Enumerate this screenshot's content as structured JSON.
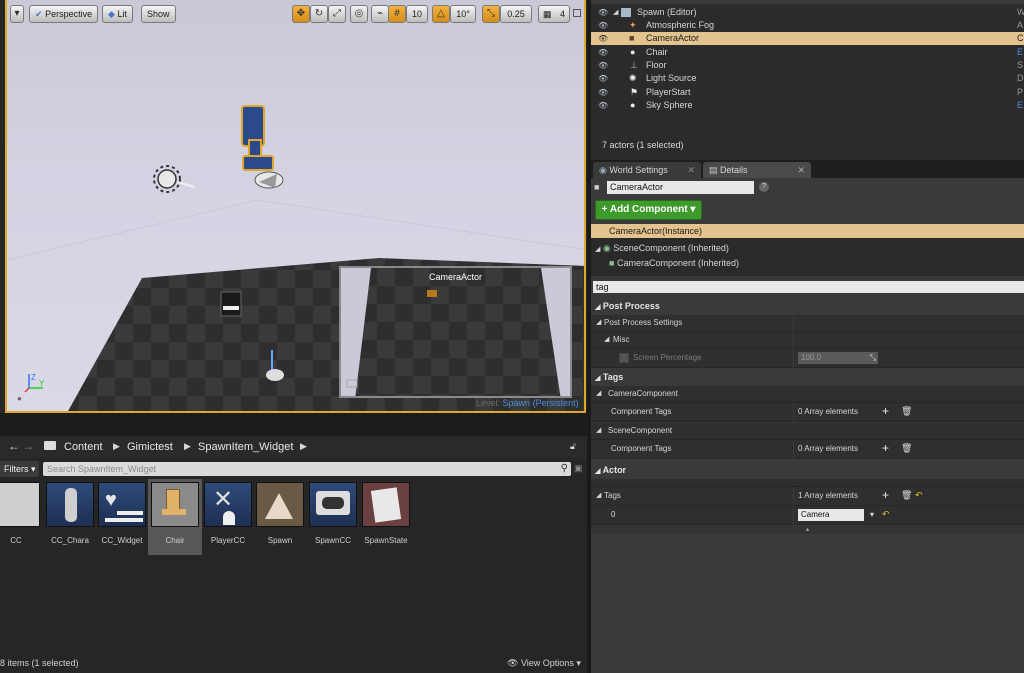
{
  "viewport": {
    "perspective_label": "Perspective",
    "lit_label": "Lit",
    "show_label": "Show",
    "grid_snap_value": "10",
    "rotation_snap_value": "10°",
    "scale_snap_value": "0.25",
    "camera_speed_value": "4",
    "pip_title": "CameraActor",
    "level_label": "Level:",
    "level_name": "Spawn (Persistent)"
  },
  "outliner": {
    "items": [
      {
        "label": "Spawn (Editor)",
        "type": "W"
      },
      {
        "label": "Atmospheric Fog",
        "type": "A"
      },
      {
        "label": "CameraActor",
        "type": "C"
      },
      {
        "label": "Chair",
        "type": "E"
      },
      {
        "label": "Floor",
        "type": "S"
      },
      {
        "label": "Light Source",
        "type": "D"
      },
      {
        "label": "PlayerStart",
        "type": "P"
      },
      {
        "label": "Sky Sphere",
        "type": "E"
      }
    ],
    "status": "7 actors (1 selected)"
  },
  "tabs": {
    "world_settings": "World Settings",
    "details": "Details"
  },
  "details": {
    "actor_name": "CameraActor",
    "add_component_label": "+ Add Component ▾",
    "instance_label": "CameraActor(Instance)",
    "components": [
      "SceneComponent (Inherited)",
      "CameraComponent (Inherited)"
    ],
    "search_value": "tag",
    "post_process": {
      "category": "Post Process",
      "settings_label": "Post Process Settings",
      "misc_label": "Misc",
      "screen_percentage_label": "Screen Percentage",
      "screen_percentage_value": "100.0"
    },
    "tags": {
      "category": "Tags",
      "camera_component_label": "CameraComponent",
      "component_tags_label": "Component Tags",
      "component_tags_value": "0 Array elements",
      "scene_component_label": "SceneComponent",
      "scene_component_tags_label": "Component Tags",
      "scene_component_tags_value": "0 Array elements"
    },
    "actor": {
      "category": "Actor",
      "tags_label": "Tags",
      "tags_value": "1 Array elements",
      "index_label": "0",
      "tag_value": "Camera"
    }
  },
  "content_browser": {
    "breadcrumb": [
      "Content",
      "Gimictest",
      "SpawnItem_Widget"
    ],
    "filters_label": "Filters ▾",
    "search_placeholder": "Search SpawnItem_Widget",
    "assets": [
      "CC",
      "CC_Chara",
      "CC_Widget",
      "Chair",
      "PlayerCC",
      "Spawn",
      "SpawnCC",
      "SpawnState"
    ],
    "status": "8 items (1 selected)",
    "view_options_label": "View Options ▾"
  },
  "colors": {
    "selection_orange": "#e0a72a",
    "add_component_green": "#3d9a2b",
    "link_blue": "#4f8edc"
  }
}
